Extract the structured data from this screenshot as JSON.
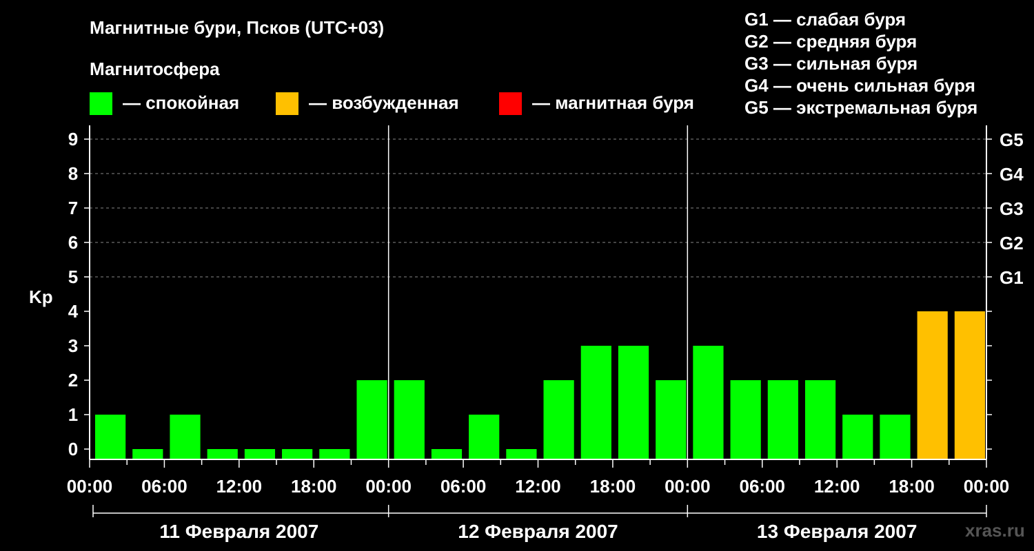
{
  "title": "Магнитные бури, Псков (UTC+03)",
  "subtitle": "Магнитосфера",
  "legend": [
    {
      "label": "— спокойная",
      "color": "#00ff00"
    },
    {
      "label": "— возбужденная",
      "color": "#ffc000"
    },
    {
      "label": "— магнитная буря",
      "color": "#ff0000"
    }
  ],
  "g_legend": [
    "G1 — слабая буря",
    "G2 — средняя буря",
    "G3 — сильная буря",
    "G4 — очень сильная буря",
    "G5 — экстремальная буря"
  ],
  "watermark": "xras.ru",
  "chart_data": {
    "type": "bar",
    "ylabel": "Kp",
    "ylim": [
      0,
      9
    ],
    "yticks": [
      "0",
      "1",
      "2",
      "3",
      "4",
      "5",
      "6",
      "7",
      "8",
      "9"
    ],
    "right_ticks": [
      {
        "value": 5,
        "label": "G1"
      },
      {
        "value": 6,
        "label": "G2"
      },
      {
        "value": 7,
        "label": "G3"
      },
      {
        "value": 8,
        "label": "G4"
      },
      {
        "value": 9,
        "label": "G5"
      }
    ],
    "grid": "horizontal dashed at 5–9",
    "xtick_labels": [
      "00:00",
      "06:00",
      "12:00",
      "18:00",
      "00:00",
      "06:00",
      "12:00",
      "18:00",
      "00:00",
      "06:00",
      "12:00",
      "18:00",
      "00:00"
    ],
    "days": [
      "11 Февраля 2007",
      "12 Февраля 2007",
      "13 Февраля 2007"
    ],
    "interval_hours": 3,
    "values": [
      1,
      0,
      1,
      0,
      0,
      0,
      0,
      2,
      2,
      0,
      1,
      0,
      2,
      3,
      3,
      2,
      3,
      2,
      2,
      2,
      1,
      1,
      4,
      4
    ],
    "colors": {
      "quiet": "#00ff00",
      "active": "#ffc000",
      "storm": "#ff0000"
    }
  }
}
